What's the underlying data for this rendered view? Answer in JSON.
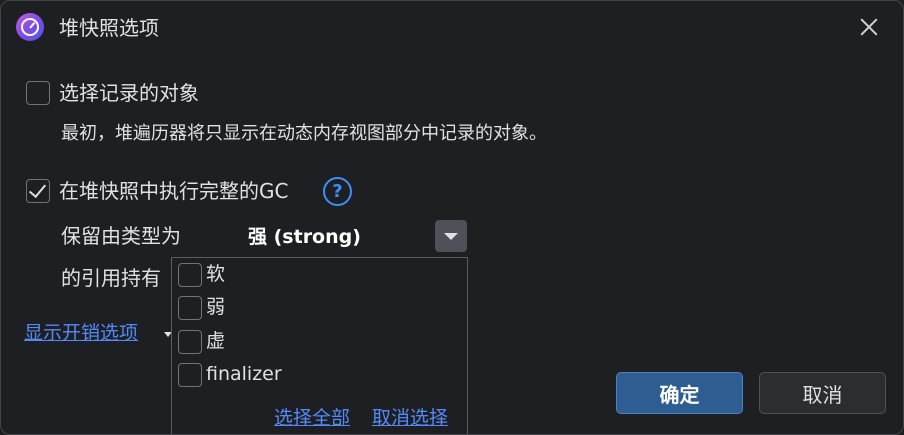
{
  "dialog": {
    "title": "堆快照选项",
    "app_icon": "profiler-app-icon",
    "close_icon": "close-icon"
  },
  "options": {
    "select_recorded": {
      "checked": false,
      "label": "选择记录的对象",
      "description": "最初，堆遍历器将只显示在动态内存视图部分中记录的对象。"
    },
    "full_gc": {
      "checked": true,
      "label": "在堆快照中执行完整的GC",
      "help_icon": "?"
    },
    "retain": {
      "label_line1": "保留由类型为",
      "label_line2": "的引用持有",
      "selected_value": "强 (strong)"
    }
  },
  "popup": {
    "items": [
      {
        "label": "软",
        "checked": false
      },
      {
        "label": "弱",
        "checked": false
      },
      {
        "label": "虚",
        "checked": false
      },
      {
        "label": "finalizer",
        "checked": false
      }
    ],
    "select_all": "选择全部",
    "deselect": "取消选择"
  },
  "show_overhead_link": "显示开销选项",
  "buttons": {
    "ok": "确定",
    "cancel": "取消"
  },
  "colors": {
    "background": "#1e1f22",
    "accent": "#548af7",
    "primary_button": "#2e5d91"
  }
}
